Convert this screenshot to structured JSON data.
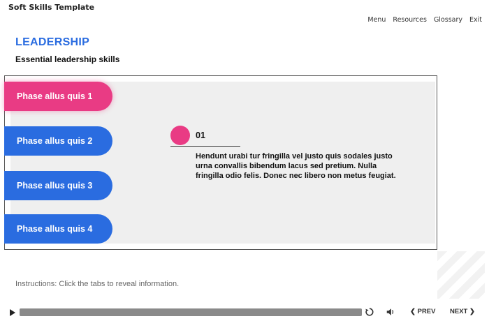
{
  "app": {
    "title": "Soft Skills Template"
  },
  "nav": {
    "menu": "Menu",
    "resources": "Resources",
    "glossary": "Glossary",
    "exit": "Exit"
  },
  "page": {
    "heading": "LEADERSHIP",
    "subheading": "Essential leadership skills"
  },
  "tabs": [
    {
      "label": "Phase allus quis 1",
      "active": true
    },
    {
      "label": "Phase allus quis 2",
      "active": false
    },
    {
      "label": "Phase allus quis 3",
      "active": false
    },
    {
      "label": "Phase allus quis 4",
      "active": false
    }
  ],
  "content": {
    "number": "01",
    "body": "Hendunt urabi tur fringilla vel justo quis sodales justo urna convallis bibendum lacus sed pretium. Nulla fringilla odio felis. Donec nec libero non metus feugiat."
  },
  "instructions": "Instructions: Click the tabs to reveal information.",
  "player": {
    "prev_label": "PREV",
    "next_label": "NEXT",
    "progress": 1.0
  },
  "colors": {
    "accent_blue": "#2a6ce0",
    "accent_pink": "#e93b84"
  }
}
